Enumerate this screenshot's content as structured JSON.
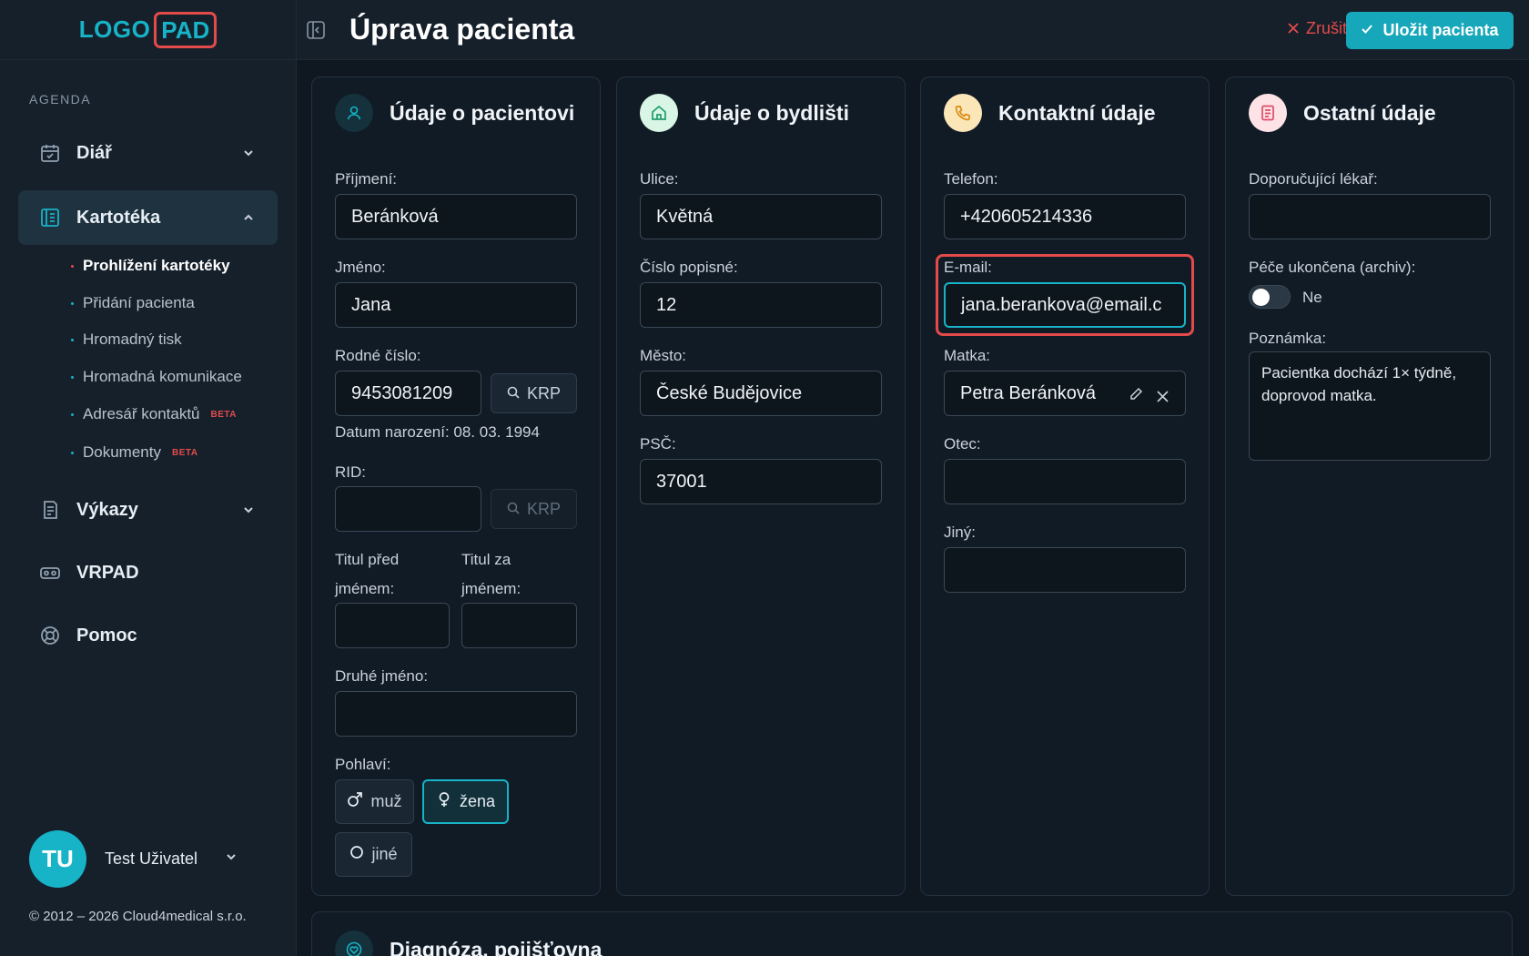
{
  "brand": {
    "logo_left": "LOGO",
    "logo_right": "PAD"
  },
  "sidebar": {
    "section_label": "AGENDA",
    "items": [
      {
        "label": "Diář",
        "icon": "calendar-icon"
      },
      {
        "label": "Kartotéka",
        "icon": "card-index-icon"
      },
      {
        "label": "Výkazy",
        "icon": "report-icon"
      },
      {
        "label": "VRPAD",
        "icon": "vr-headset-icon"
      },
      {
        "label": "Pomoc",
        "icon": "lifebuoy-icon"
      }
    ],
    "subitems": [
      {
        "label": "Prohlížení kartotéky"
      },
      {
        "label": "Přidání pacienta"
      },
      {
        "label": "Hromadný tisk"
      },
      {
        "label": "Hromadná komunikace"
      },
      {
        "label": "Adresář kontaktů",
        "badge": "BETA"
      },
      {
        "label": "Dokumenty",
        "badge": "BETA"
      }
    ],
    "user": {
      "initials": "TU",
      "name": "Test Uživatel"
    },
    "copyright": "© 2012 – 2026 Cloud4medical s.r.o."
  },
  "header": {
    "title": "Úprava pacienta",
    "cancel_label": "Zrušit",
    "save_label": "Uložit pacienta"
  },
  "patient": {
    "title": "Údaje o pacientovi",
    "surname_label": "Příjmení:",
    "surname": "Beránková",
    "name_label": "Jméno:",
    "name": "Jana",
    "birth_number_label": "Rodné číslo:",
    "birth_number": "9453081209",
    "krp_label": "KRP",
    "birth_date_text": "Datum narození: 08. 03. 1994",
    "rid_label": "RID:",
    "rid": "",
    "title_before_label_1": "Titul před",
    "title_before_label_2": "jménem:",
    "title_after_label_1": "Titul za",
    "title_after_label_2": "jménem:",
    "second_name_label": "Druhé jméno:",
    "gender_label": "Pohlaví:",
    "gender_male": "muž",
    "gender_female": "žena",
    "gender_other": "jiné"
  },
  "residence": {
    "title": "Údaje o bydlišti",
    "street_label": "Ulice:",
    "street": "Květná",
    "number_label": "Číslo popisné:",
    "number": "12",
    "city_label": "Město:",
    "city": "České Budějovice",
    "zip_label": "PSČ:",
    "zip": "37001"
  },
  "contact": {
    "title": "Kontaktní údaje",
    "phone_label": "Telefon:",
    "phone": "+420605214336",
    "email_label": "E-mail:",
    "email": "jana.berankova@email.c",
    "mother_label": "Matka:",
    "mother": "Petra Beránková",
    "father_label": "Otec:",
    "other_label": "Jiný:"
  },
  "other": {
    "title": "Ostatní údaje",
    "doctor_label": "Doporučující lékař:",
    "archive_label": "Péče ukončena (archiv):",
    "archive_value": "Ne",
    "note_label": "Poznámka:",
    "note": "Pacientka dochází 1× týdně, doprovod matka."
  },
  "diagnosis": {
    "title": "Diagnóza, pojišťovna"
  },
  "colors": {
    "accent": "#17b3c7",
    "danger": "#e34b4b"
  }
}
